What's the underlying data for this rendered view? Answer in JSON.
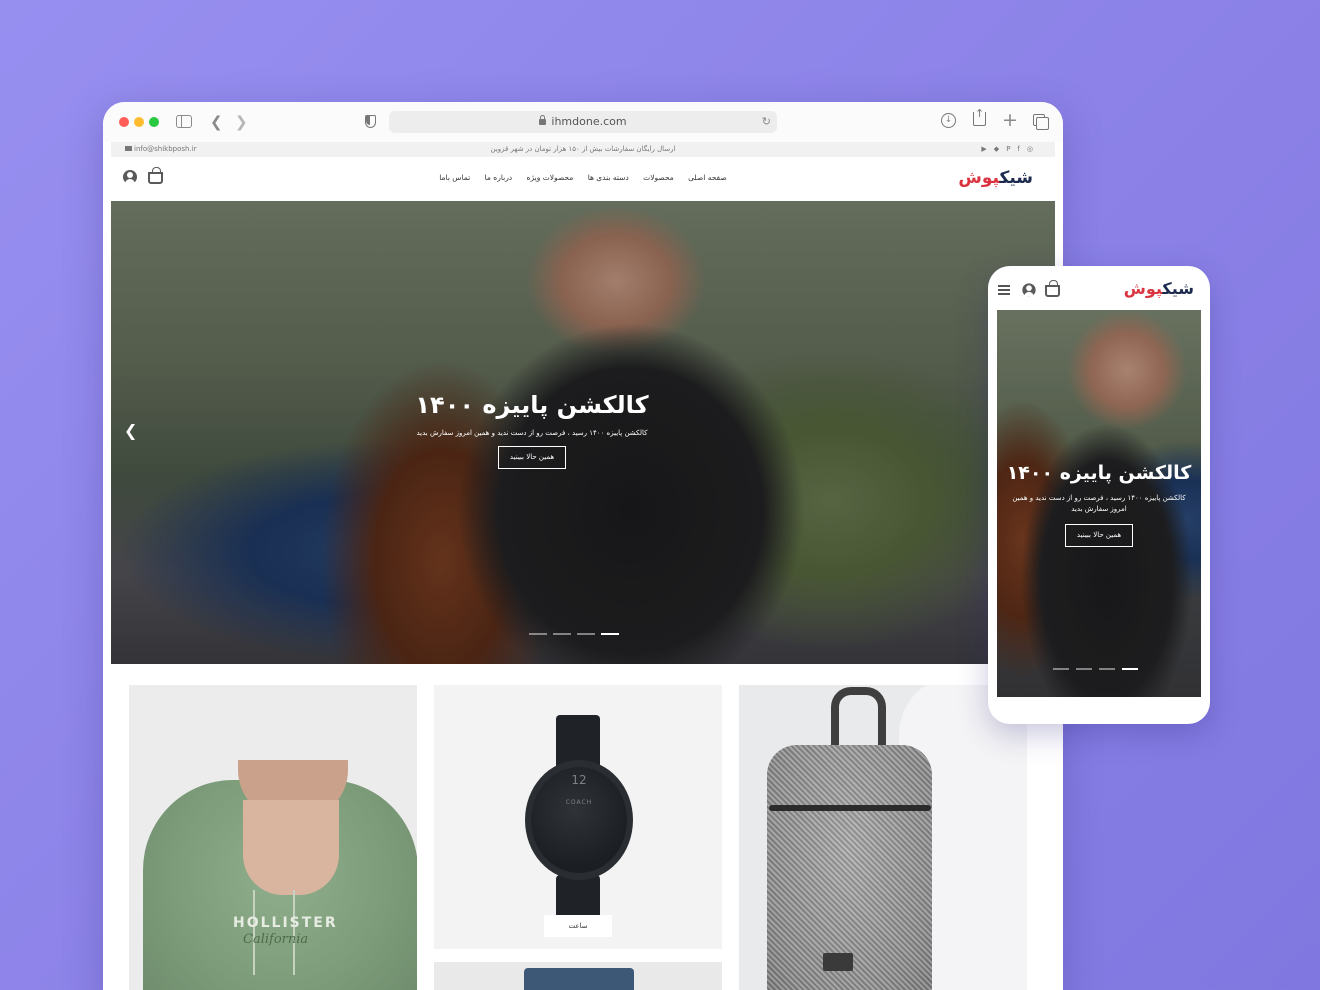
{
  "browser": {
    "url": "ihmdone.com"
  },
  "site": {
    "topbar": {
      "email": "info@shikbposh.ir",
      "message": "ارسال رایگان سفارشات بیش از ۱۵۰ هزار تومان در شهر قزوین",
      "social_icons": [
        "instagram-icon",
        "facebook-icon",
        "pinterest-icon",
        "snapchat-icon",
        "youtube-icon"
      ]
    },
    "logo": {
      "main": "شیک",
      "accent": "پوش"
    },
    "nav": {
      "items": [
        {
          "label": "صفحه اصلی"
        },
        {
          "label": "محصولات"
        },
        {
          "label": "دسته بندی ها"
        },
        {
          "label": "محصولات ویژه"
        },
        {
          "label": "درباره ما"
        },
        {
          "label": "تماس باما"
        }
      ]
    },
    "hero": {
      "title": "کالکشن پاییزه ۱۴۰۰",
      "subtitle": "کالکشن پاییزه ۱۴۰۰ رسید ، فرصت رو از دست ندید و همین امروز سفارش بدید",
      "button": "همین حالا ببینید",
      "slide_count": 4,
      "active_slide": 4
    },
    "products": [
      {
        "name": "hoodie",
        "hoodie_print": "HOLLISTER",
        "hoodie_script": "California"
      },
      {
        "name": "watch",
        "label": "ساعت",
        "watch_dial": "12",
        "watch_brand": "COACH"
      },
      {
        "name": "backpack"
      }
    ]
  },
  "mobile": {
    "hero": {
      "title": "کالکشن پاییزه ۱۴۰۰",
      "subtitle": "کالکشن پاییزه ۱۴۰۰ رسید ، فرصت رو از دست ندید و همین امروز سفارش بدید",
      "button": "همین حالا ببینید"
    }
  },
  "colors": {
    "background": "#8f86ea",
    "logo_primary": "#1b2a4e",
    "logo_accent": "#d9343f"
  }
}
